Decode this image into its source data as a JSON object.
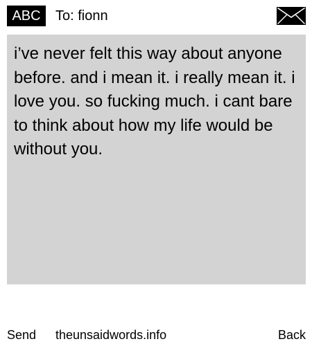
{
  "header": {
    "mode_label": "ABC",
    "recipient_label": "To: fionn",
    "envelope_icon": "envelope-icon"
  },
  "message": {
    "body": "i’ve never felt this way about anyone before. and i mean it. i really mean it. i love you. so fucking much. i cant bare to think about how my life would be without you."
  },
  "footer": {
    "send_label": "Send",
    "site_label": "theunsaidwords.info",
    "back_label": "Back"
  },
  "colors": {
    "background": "#ffffff",
    "message_area": "#d3d3d3",
    "badge": "#000000",
    "text": "#000000"
  }
}
